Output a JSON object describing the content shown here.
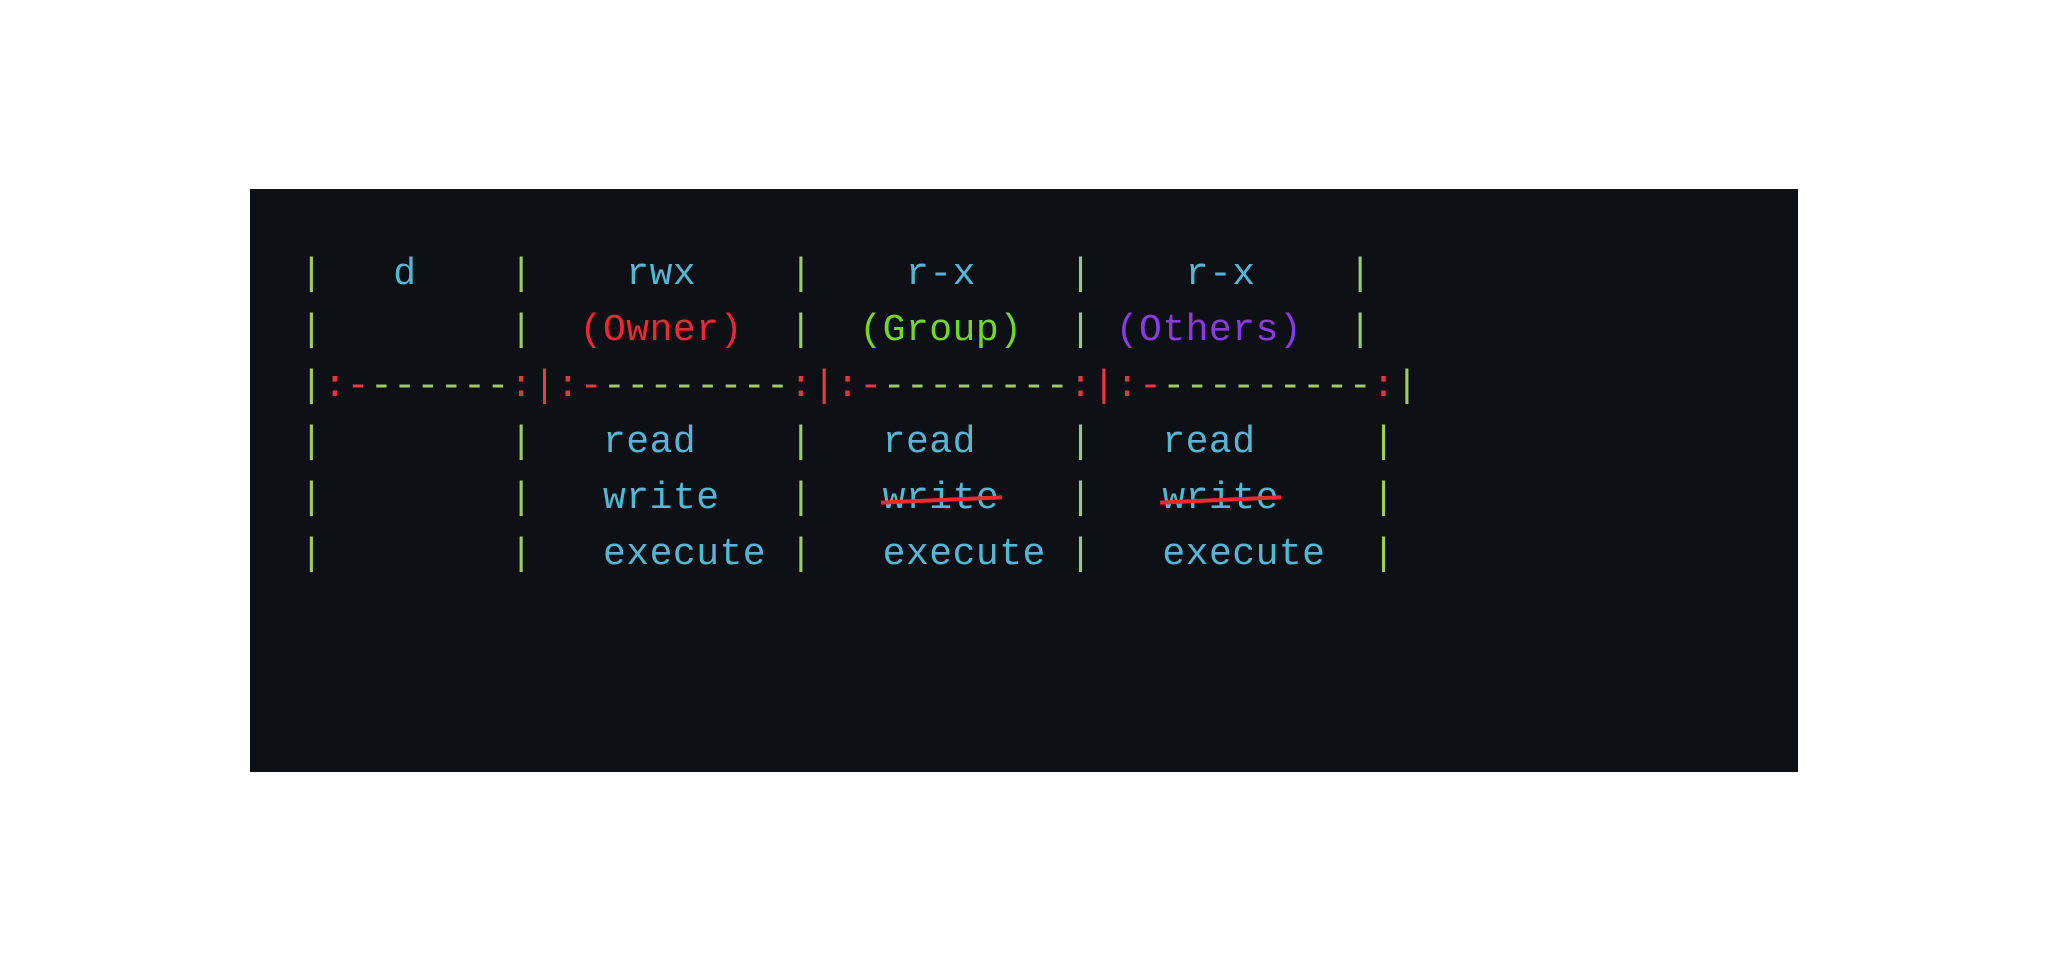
{
  "type_col": {
    "code": "d"
  },
  "owner": {
    "code": "rwx",
    "label": "(Owner)",
    "perms": [
      {
        "name": "read",
        "granted": true
      },
      {
        "name": "write",
        "granted": true
      },
      {
        "name": "execute",
        "granted": true
      }
    ]
  },
  "group": {
    "code": "r-x",
    "label": "(Group)",
    "perms": [
      {
        "name": "read",
        "granted": true
      },
      {
        "name": "write",
        "granted": false
      },
      {
        "name": "execute",
        "granted": true
      }
    ]
  },
  "others": {
    "code": "r-x",
    "label": "(Others)",
    "perms": [
      {
        "name": "read",
        "granted": true
      },
      {
        "name": "write",
        "granted": false
      },
      {
        "name": "execute",
        "granted": true
      }
    ]
  }
}
